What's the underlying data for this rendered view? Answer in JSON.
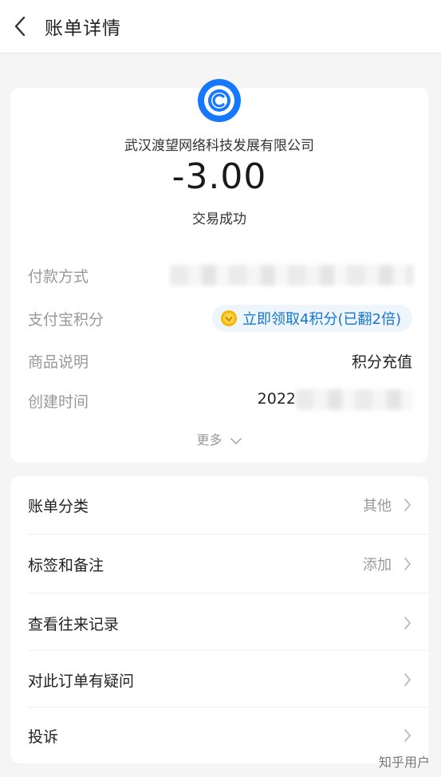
{
  "header": {
    "title": "账单详情"
  },
  "summary": {
    "merchant": "武汉渡望网络科技发展有限公司",
    "amount": "-3.00",
    "status": "交易成功"
  },
  "details": {
    "payment_method_label": "付款方式",
    "points_label": "支付宝积分",
    "points_action": "立即领取4积分(已翻2倍)",
    "product_label": "商品说明",
    "product_value": "积分充值",
    "created_label": "创建时间",
    "created_value_prefix": "2022",
    "more_label": "更多"
  },
  "actions": [
    {
      "label": "账单分类",
      "value": "其他"
    },
    {
      "label": "标签和备注",
      "value": "添加"
    },
    {
      "label": "查看往来记录",
      "value": ""
    },
    {
      "label": "对此订单有疑问",
      "value": ""
    },
    {
      "label": "投诉",
      "value": ""
    }
  ],
  "watermark": "知乎用户",
  "colors": {
    "accent": "#1677d2",
    "logo": "#1677ff",
    "coin": "#f5b700"
  }
}
